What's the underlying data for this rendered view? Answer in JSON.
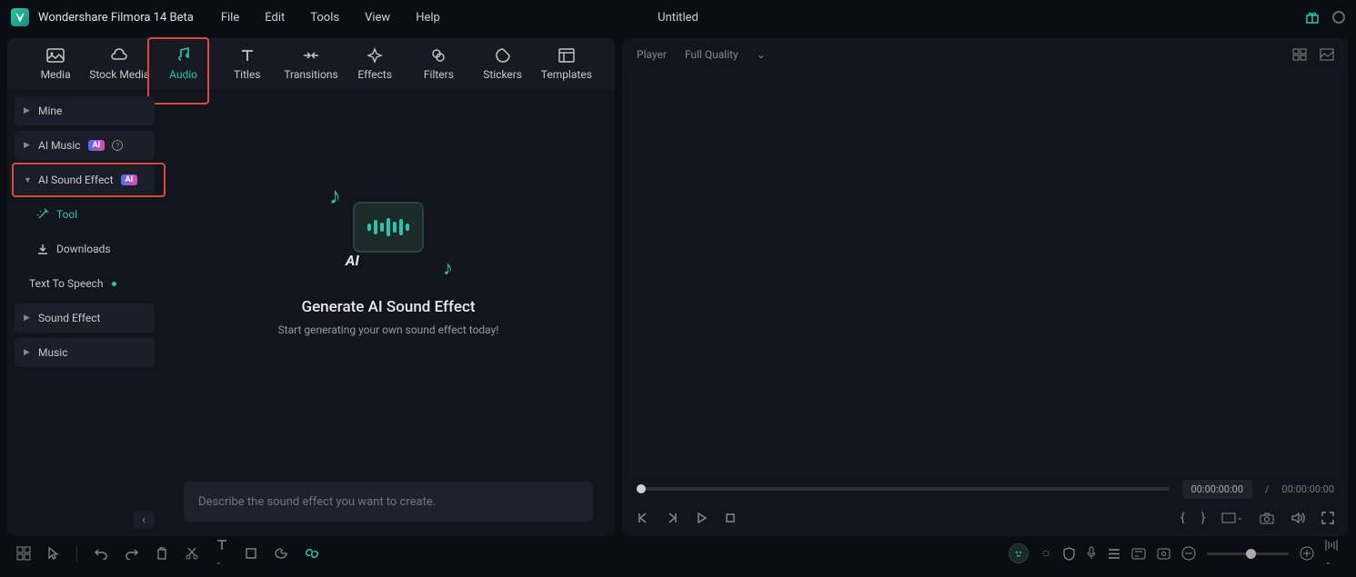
{
  "app": {
    "title": "Wondershare Filmora 14 Beta",
    "project": "Untitled"
  },
  "menu": [
    "File",
    "Edit",
    "Tools",
    "View",
    "Help"
  ],
  "tabs": [
    {
      "label": "Media"
    },
    {
      "label": "Stock Media"
    },
    {
      "label": "Audio"
    },
    {
      "label": "Titles"
    },
    {
      "label": "Transitions"
    },
    {
      "label": "Effects"
    },
    {
      "label": "Filters"
    },
    {
      "label": "Stickers"
    },
    {
      "label": "Templates"
    }
  ],
  "sidebar": {
    "items": [
      {
        "label": "Mine"
      },
      {
        "label": "AI Music",
        "badge": "AI"
      },
      {
        "label": "AI Sound Effect",
        "badge": "AI"
      },
      {
        "label": "Tool"
      },
      {
        "label": "Downloads"
      },
      {
        "label": "Text To Speech"
      },
      {
        "label": "Sound Effect"
      },
      {
        "label": "Music"
      }
    ]
  },
  "center": {
    "title": "Generate AI Sound Effect",
    "subtitle": "Start generating your own sound effect today!",
    "placeholder": "Describe the sound effect you want to create."
  },
  "player": {
    "label": "Player",
    "quality": "Full Quality",
    "current": "00:00:00:00",
    "total": "00:00:00:00",
    "sep": "/"
  }
}
